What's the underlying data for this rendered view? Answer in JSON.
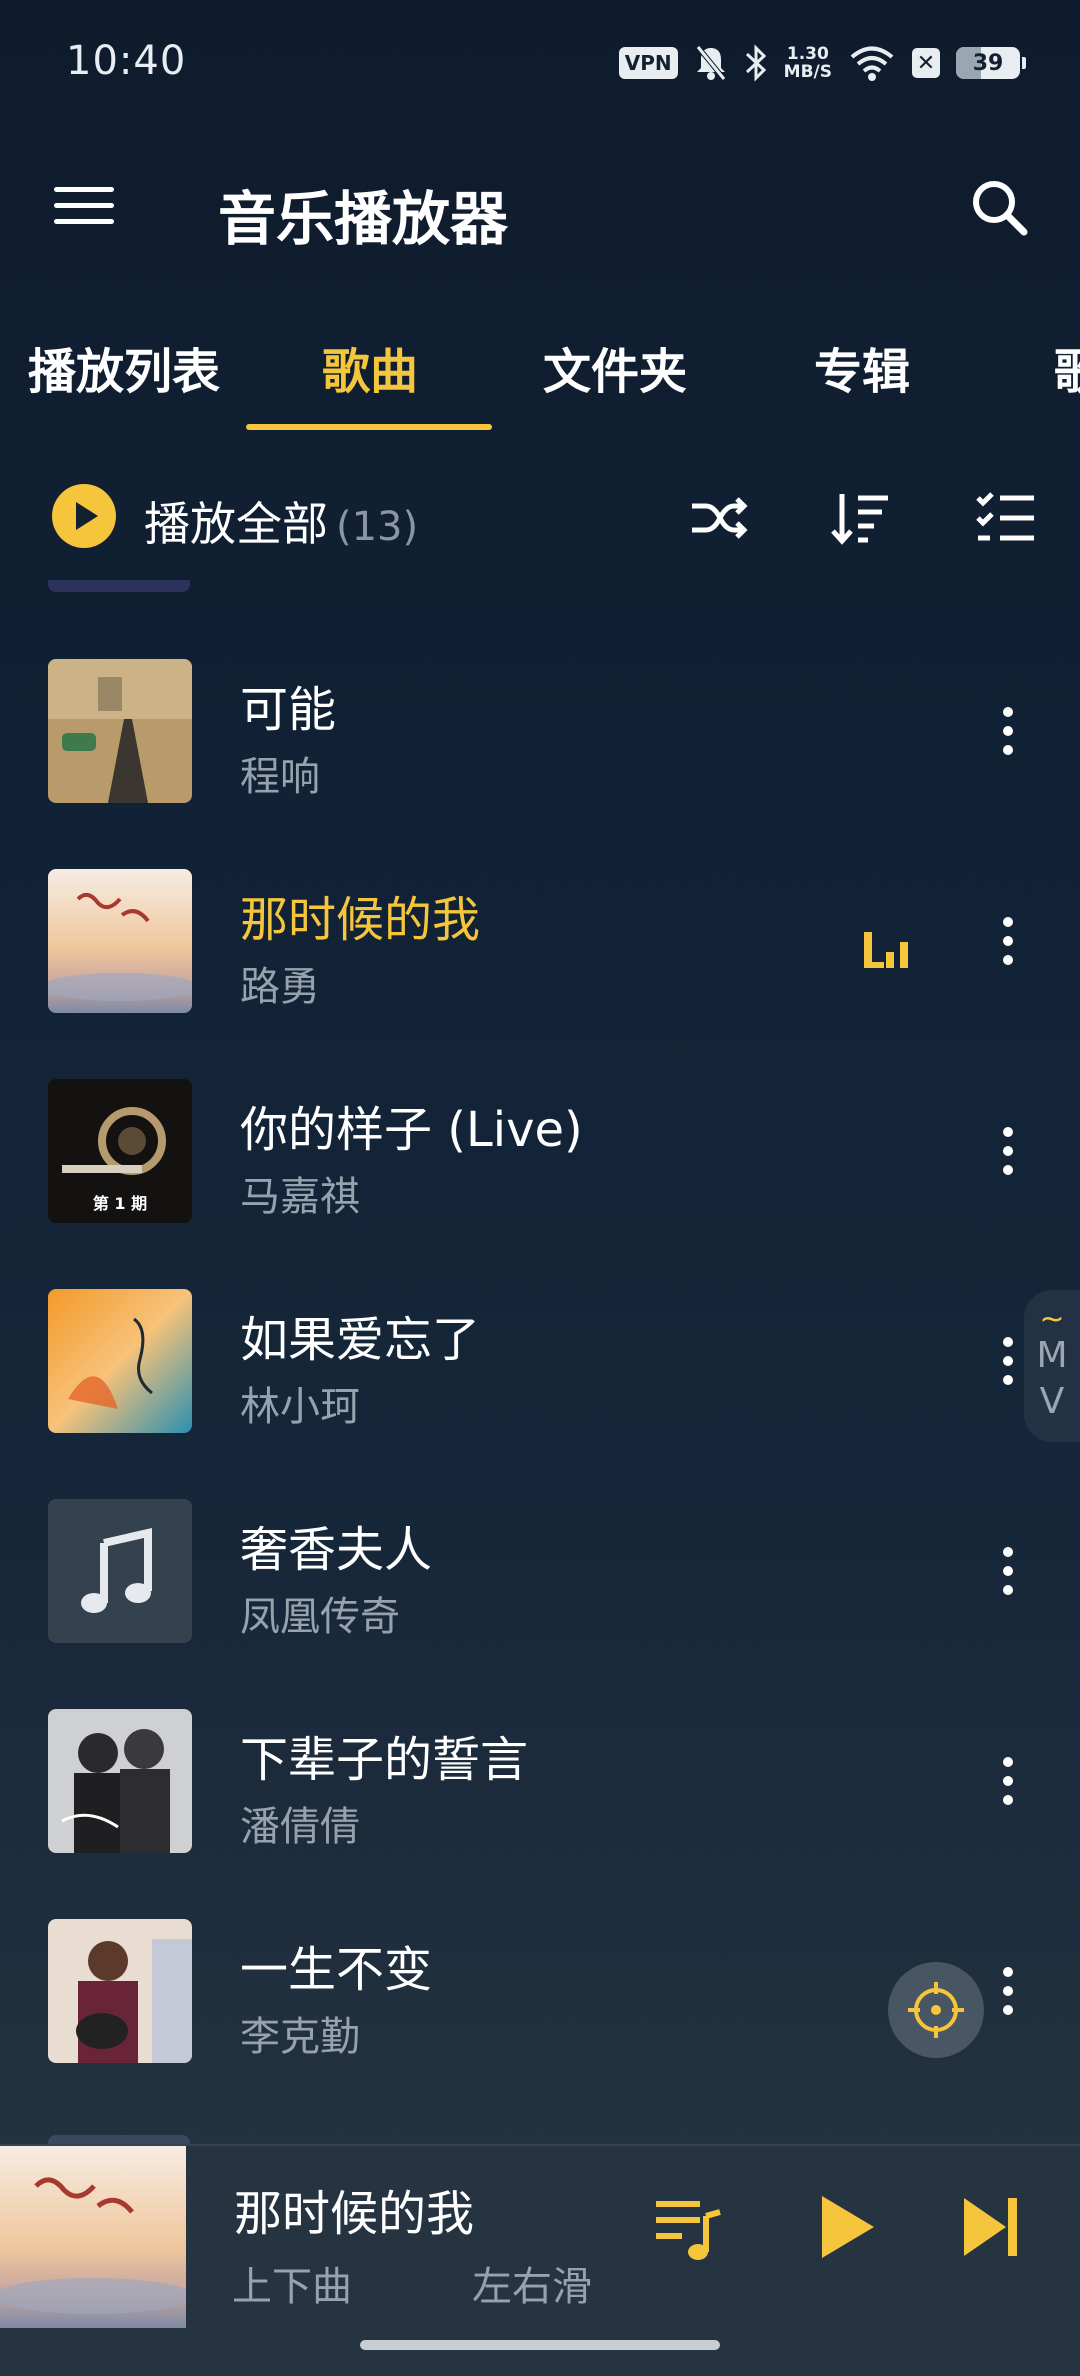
{
  "status_bar": {
    "time": "10:40",
    "vpn": "VPN",
    "net_speed_value": "1.30",
    "net_speed_unit": "MB/S",
    "x_badge": "✕",
    "battery": "39",
    "battery_level_percent": 39,
    "icons": [
      "vpn-icon",
      "mute-bell-icon",
      "bluetooth-icon",
      "wifi-icon",
      "x-notification-icon",
      "battery-icon"
    ]
  },
  "app_bar": {
    "title": "音乐播放器",
    "menu_icon": "hamburger-menu-icon",
    "search_icon": "search-icon"
  },
  "tabs": [
    {
      "label": "播放列表"
    },
    {
      "label": "歌曲",
      "active": true
    },
    {
      "label": "文件夹"
    },
    {
      "label": "专辑"
    },
    {
      "label": "歌"
    }
  ],
  "toolbar": {
    "play_all_label": "播放全部",
    "count": "(13)",
    "icons": [
      "play-circle-icon",
      "shuffle-icon",
      "sort-icon",
      "multi-select-icon"
    ]
  },
  "songs": [
    {
      "title": "可能",
      "artist": "程响"
    },
    {
      "title": "那时候的我",
      "artist": "路勇",
      "current": true
    },
    {
      "title": "你的样子 (Live)",
      "artist": "马嘉祺",
      "cover_text": "第 1 期"
    },
    {
      "title": "如果爱忘了",
      "artist": "林小珂"
    },
    {
      "title": "奢香夫人",
      "artist": "凤凰传奇"
    },
    {
      "title": "下辈子的誓言",
      "artist": "潘倩倩"
    },
    {
      "title": "一生不变",
      "artist": "李克勤"
    }
  ],
  "side_tab": {
    "tilde": "~",
    "label_m": "M",
    "label_v": "V"
  },
  "mini_player": {
    "title": "那时候的我",
    "hint_left": "上下曲",
    "hint_right": "左右滑",
    "icons": [
      "playlist-icon",
      "play-icon",
      "skip-next-icon"
    ]
  },
  "colors": {
    "accent": "#f5c63b",
    "background": "#112236",
    "secondary_text": "#96a2ae"
  }
}
